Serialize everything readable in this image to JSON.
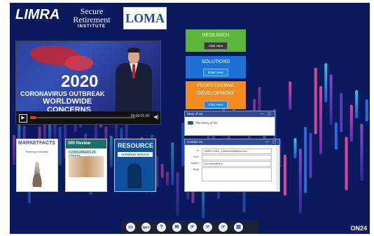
{
  "header": {
    "limra_logo": "LIMRA",
    "sri_logo_line1": "Secure",
    "sri_logo_line2": "Retirement",
    "sri_logo_line3": "INSTITUTE",
    "loma_logo": "LOMA"
  },
  "video": {
    "year": "2020",
    "caption_line1": "CORONAVIRUS OUTBREAK",
    "caption_line2": "WORLDWIDE",
    "caption_line3": "CONCERNS",
    "time": "00:02:01:30",
    "progress_fraction": 0.05
  },
  "links": {
    "research_title": "RESEARCH",
    "research_button": "Click Here",
    "solutions_title": "SOLUTIONS",
    "solutions_button": "Enter Here",
    "profdev_title_line1": "PROFESSIONAL",
    "profdev_title_line2": "DEVELOPMENT",
    "profdev_button": "Click Here"
  },
  "story_window": {
    "title": "Story of Us",
    "item": "The Story of Us"
  },
  "contact_window": {
    "title": "Contact Us",
    "to_label": "To",
    "to_value": "LIMRA-LOMA_Conferences@limra.com",
    "from_label": "From",
    "subject_label": "Subject",
    "subject_value": "I am interested in...",
    "body_label": "Body"
  },
  "publications": {
    "market_facts_title": "MARKETFACTS",
    "market_facts_subtitle": "Reacting to Mortality",
    "sri_review_title": "SRI Review",
    "sri_review_headline": "CONSUMERS IN CRISIS",
    "resource_title": "RESOURCE",
    "resource_subtitle": "SUPERIOR SERVICE"
  },
  "toolbar": {
    "qa_label": "Q&A",
    "help_label": "?",
    "brand": "ON24"
  },
  "colors": {
    "background": "#0b1a5e",
    "research": "#5cb63a",
    "solutions": "#1e6fd8",
    "profdev": "#f28b22"
  }
}
